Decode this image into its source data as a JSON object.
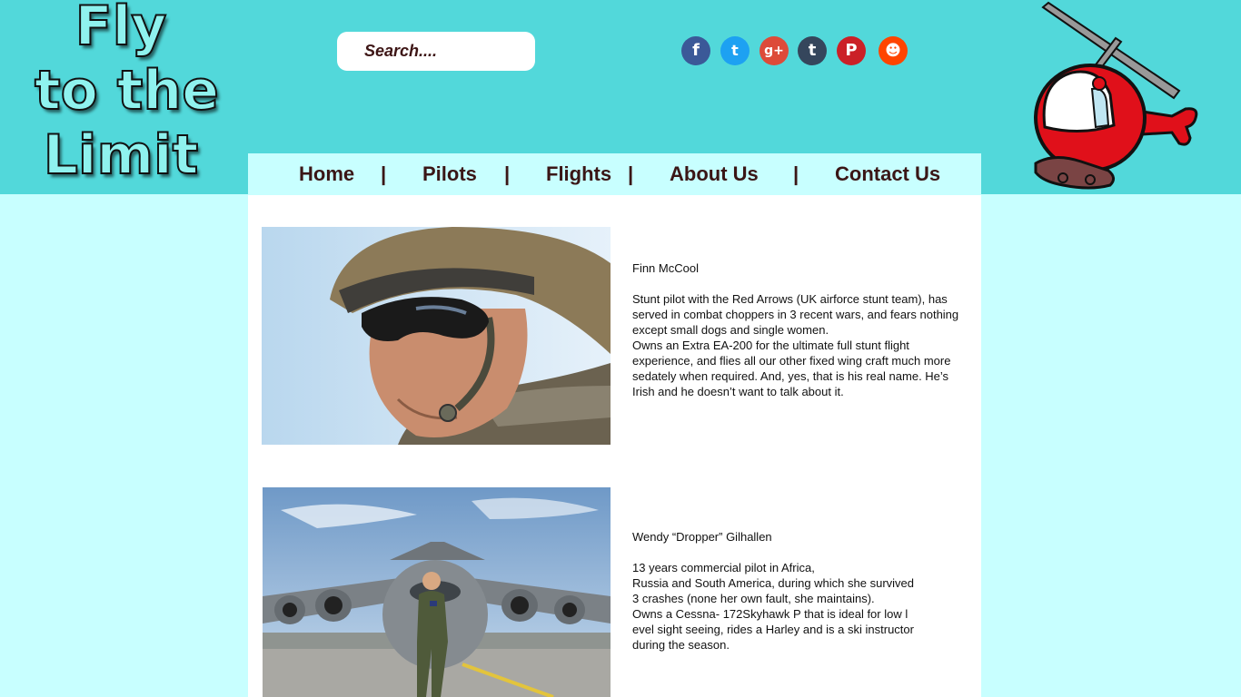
{
  "logo": {
    "lines": [
      "Fly",
      "to the",
      "Limit"
    ]
  },
  "search": {
    "placeholder": "Search...."
  },
  "social": [
    {
      "name": "facebook-icon",
      "glyph": "f",
      "color": "#3b5998"
    },
    {
      "name": "twitter-icon",
      "glyph": "t",
      "color": "#1da1f2"
    },
    {
      "name": "google-plus-icon",
      "glyph": "g+",
      "color": "#dd4b39"
    },
    {
      "name": "tumblr-icon",
      "glyph": "t",
      "color": "#35465c"
    },
    {
      "name": "pinterest-icon",
      "glyph": "P",
      "color": "#cb2027"
    },
    {
      "name": "reddit-icon",
      "glyph": "☻",
      "color": "#ff4500"
    }
  ],
  "nav": {
    "items": [
      "Home",
      "Pilots",
      "Flights",
      "About Us",
      "Contact Us"
    ],
    "separator": "|"
  },
  "pilots": [
    {
      "name": "Finn McCool",
      "paragraphs": [
        "Stunt pilot with the Red Arrows (UK airforce stunt team), has served in combat choppers in 3 recent wars, and fears nothing except small dogs and single women.",
        "Owns an Extra EA-200 for the ultimate full stunt flight experience, and flies all our other fixed wing craft much more sedately when required. And, yes, that is his real name. He’s Irish and he doesn’t want to talk about it."
      ]
    },
    {
      "name": "Wendy “Dropper” Gilhallen",
      "paragraphs": [
        "13 years commercial pilot in Africa,",
        "Russia and South America, during which she survived",
        "3 crashes (none her own fault, she maintains).",
        "Owns a Cessna- 172Skyhawk P that is ideal for low l",
        "evel sight seeing, rides a Harley and is a ski instructor",
        "during the season."
      ]
    }
  ],
  "colors": {
    "header": "#52d8da",
    "page": "#c8ffff",
    "nav_text": "#3a1616"
  }
}
